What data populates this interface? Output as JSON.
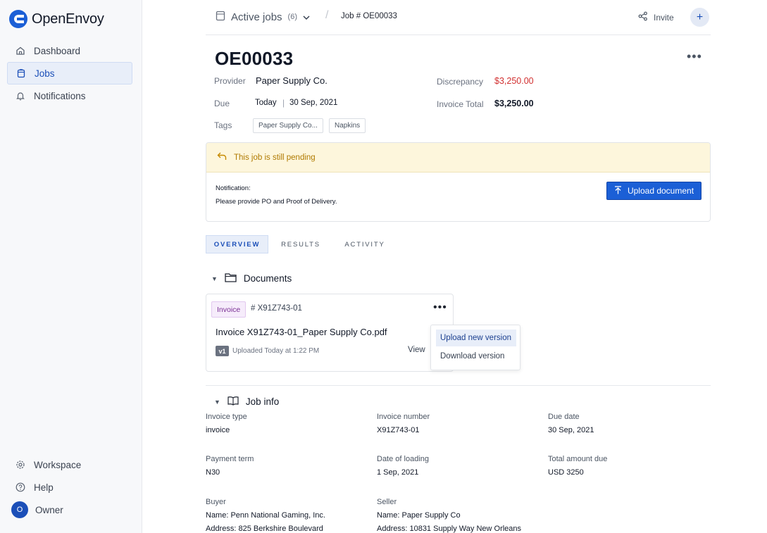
{
  "app": {
    "name": "OpenEnvoy",
    "brand_color": "#1b5fd6"
  },
  "sidebar": {
    "items": [
      {
        "label": "Dashboard",
        "icon": "home-icon",
        "active": false
      },
      {
        "label": "Jobs",
        "icon": "clipboard-icon",
        "active": true
      },
      {
        "label": "Notifications",
        "icon": "bell-icon",
        "active": false
      }
    ],
    "bottom": {
      "workspace": "Workspace",
      "help": "Help",
      "owner": "Owner",
      "owner_initial": "O"
    }
  },
  "header": {
    "breadcrumb_jobs": "Active jobs",
    "jobs_count": "(6)",
    "breadcrumb_separator": "/",
    "breadcrumb_job": "Job # OE00033",
    "invite": "Invite",
    "add": "+"
  },
  "job": {
    "title": "OE00033",
    "more": "•••",
    "provider_label": "Provider",
    "provider": "Paper Supply Co.",
    "due_label": "Due",
    "due_today": "Today",
    "due_date": "30 Sep, 2021",
    "discrepancy_label": "Discrepancy",
    "discrepancy": "$3,250.00",
    "invoice_total_label": "Invoice Total",
    "invoice_total": "$3,250.00",
    "tags_label": "Tags",
    "tags": [
      "Paper Supply Co...",
      "Napkins"
    ],
    "discrepancy_color": "#d12f2f"
  },
  "pending": {
    "status": "This job is still pending",
    "notification_label": "Notification:",
    "notification_text": "Please provide PO and Proof of Delivery.",
    "upload_button": "Upload document",
    "status_color": "#b07a00"
  },
  "tabs": [
    {
      "label": "OVERVIEW",
      "active": true
    },
    {
      "label": "RESULTS",
      "active": false
    },
    {
      "label": "ACTIVITY",
      "active": false
    }
  ],
  "documents": {
    "heading": "Documents",
    "card": {
      "type": "Invoice",
      "id": "# X91Z743-01",
      "more": "•••",
      "filename": "Invoice X91Z743-01_Paper Supply Co.pdf",
      "version": "v1",
      "uploaded": "Uploaded Today at 1:22 PM",
      "view": "View"
    },
    "menu": [
      "Upload new version",
      "Download version"
    ]
  },
  "job_info": {
    "heading": "Job info",
    "fields": [
      {
        "label": "Invoice type",
        "value": "invoice"
      },
      {
        "label": "Invoice number",
        "value": "X91Z743-01"
      },
      {
        "label": "Due date",
        "value": "30 Sep, 2021"
      },
      {
        "label": "Payment term",
        "value": "N30"
      },
      {
        "label": "Date of loading",
        "value": "1 Sep, 2021"
      },
      {
        "label": "Total amount due",
        "value": "USD 3250"
      },
      {
        "label": "Buyer",
        "value": "Name: Penn National Gaming, Inc.",
        "value2": "Address: 825 Berkshire Boulevard"
      },
      {
        "label": "Seller",
        "value": "Name: Paper Supply Co",
        "value2": "Address: 10831 Supply Way New Orleans"
      }
    ]
  }
}
